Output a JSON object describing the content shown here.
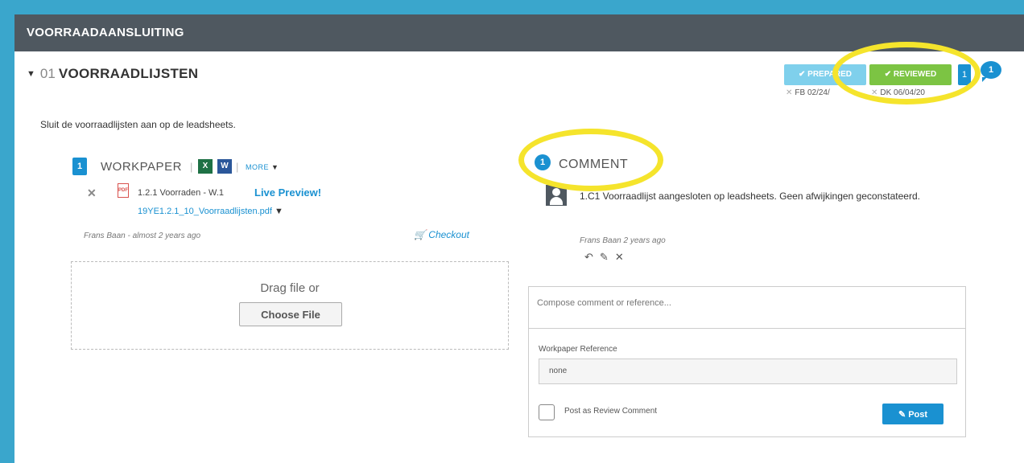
{
  "header": {
    "title": "VOORRAADAANSLUITING"
  },
  "section": {
    "number": "01",
    "title": "VOORRAADLIJSTEN",
    "description": "Sluit de voorraadlijsten aan op de leadsheets."
  },
  "signoffs": {
    "prepared_label": "✔ PREPARED",
    "reviewed_label": "✔ REVIEWED",
    "count": "1",
    "comment_count": "1",
    "prepared_by": "FB 02/24/",
    "reviewed_by": "DK 06/04/20"
  },
  "workpaper": {
    "icon_count": "1",
    "label": "WORKPAPER",
    "sep": "|",
    "more_label": "MORE",
    "file_name": "1.2.1 Voorraden - W.1",
    "live_preview": "Live Preview!",
    "file_link": "19YE1.2.1_10_Voorraadlijsten.pdf",
    "meta": "Frans Baan - almost 2 years ago",
    "checkout": "Checkout",
    "drop_text": "Drag file or",
    "choose_file": "Choose File"
  },
  "comments": {
    "count": "1",
    "title": "COMMENT",
    "items": [
      {
        "text": "1.C1 Voorraadlijst aangesloten op leadsheets. Geen afwijkingen geconstateerd.",
        "meta": "Frans Baan 2 years ago"
      }
    ]
  },
  "compose": {
    "placeholder": "Compose comment or reference...",
    "ref_label": "Workpaper Reference",
    "ref_value": "none",
    "review_label": "Post as Review Comment",
    "post_label": "Post"
  },
  "colors": {
    "accent": "#1a91d1",
    "header": "#4f5860",
    "prepared": "#7fd0ec",
    "reviewed": "#7cc443",
    "highlight": "#f5e42c"
  }
}
